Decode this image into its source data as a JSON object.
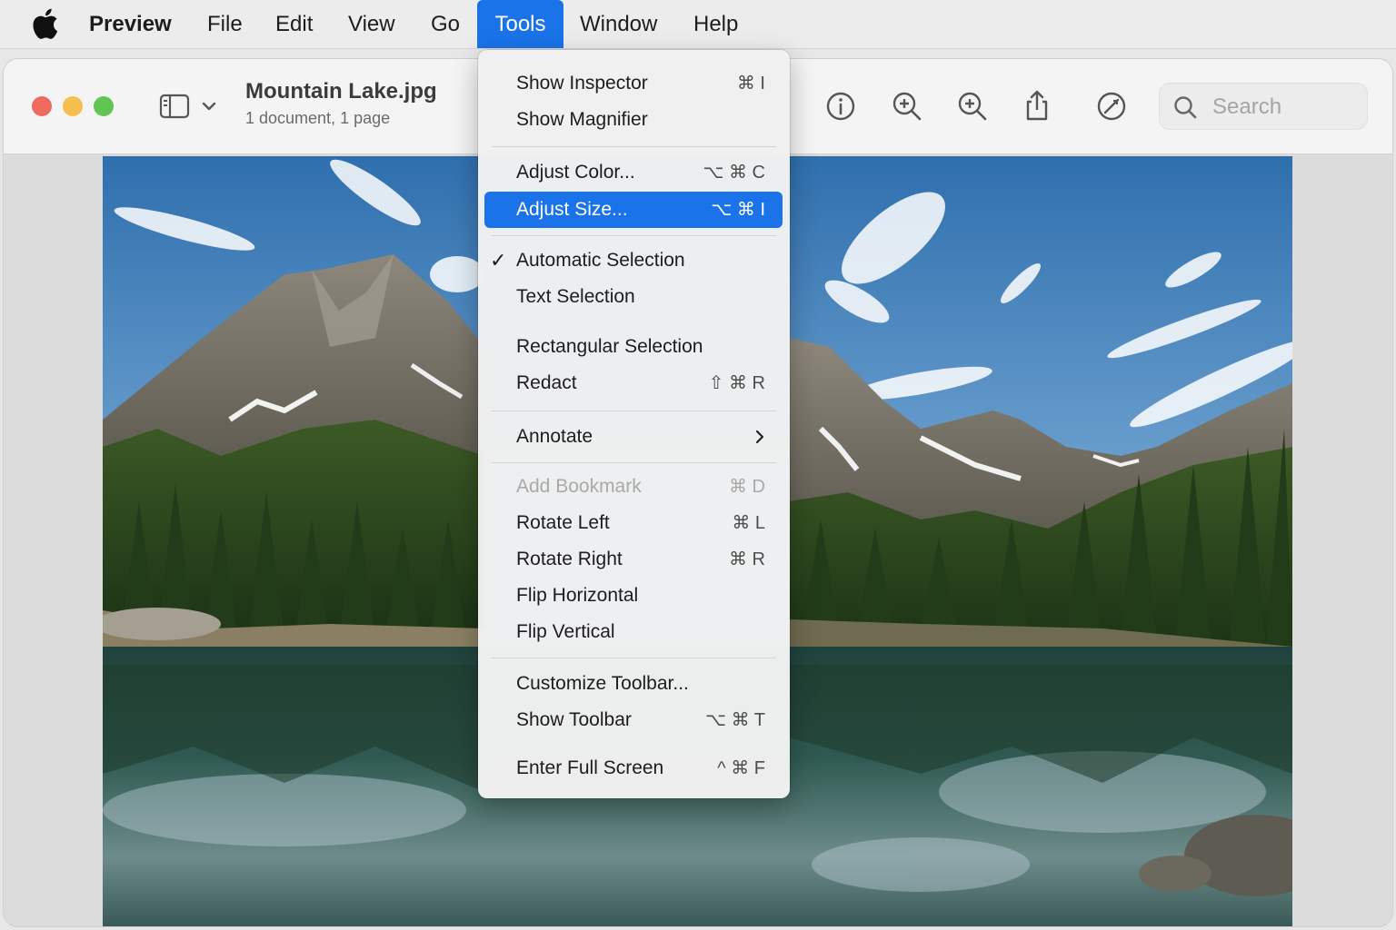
{
  "menubar": {
    "apple_icon": "apple-logo-icon",
    "app_name": "Preview",
    "menus": [
      "File",
      "Edit",
      "View",
      "Go",
      "Tools",
      "Window",
      "Help"
    ],
    "open_menu": "Tools"
  },
  "window": {
    "title": "Mountain Lake.jpg",
    "subtitle": "1 document, 1 page",
    "traffic_lights": {
      "close": "#ee6a5e",
      "minimize": "#f5bf4f",
      "zoom": "#61c554"
    },
    "toolbar_icons": [
      "sidebar-icon",
      "chevron-down-icon",
      "info-icon",
      "zoom-out-icon",
      "zoom-in-icon",
      "share-icon",
      "markup-icon",
      "search-icon"
    ],
    "search": {
      "placeholder": "Search"
    }
  },
  "tools_menu": {
    "highlight_color": "#1a73e8",
    "items": [
      {
        "label": "Show Inspector",
        "shortcut": "⌘ I"
      },
      {
        "label": "Show Magnifier",
        "shortcut": ""
      },
      {
        "label": "Adjust Color...",
        "shortcut": "⌥ ⌘ C"
      },
      {
        "label": "Adjust Size...",
        "shortcut": "⌥ ⌘ I",
        "highlighted": true
      },
      {
        "label": "Automatic Selection",
        "shortcut": "",
        "checked": true,
        "check": "✓"
      },
      {
        "label": "Text Selection",
        "shortcut": ""
      },
      {
        "label": "Rectangular Selection",
        "shortcut": ""
      },
      {
        "label": "Redact",
        "shortcut": "⇧ ⌘ R"
      },
      {
        "label": "Annotate",
        "shortcut": "",
        "submenu": true
      },
      {
        "label": "Add Bookmark",
        "shortcut": "⌘ D",
        "disabled": true
      },
      {
        "label": "Rotate Left",
        "shortcut": "⌘ L"
      },
      {
        "label": "Rotate Right",
        "shortcut": "⌘ R"
      },
      {
        "label": "Flip Horizontal",
        "shortcut": ""
      },
      {
        "label": "Flip Vertical",
        "shortcut": ""
      },
      {
        "label": "Customize Toolbar...",
        "shortcut": ""
      },
      {
        "label": "Show Toolbar",
        "shortcut": "⌥ ⌘ T"
      },
      {
        "label": "Enter Full Screen",
        "shortcut": "^ ⌘ F"
      }
    ]
  }
}
